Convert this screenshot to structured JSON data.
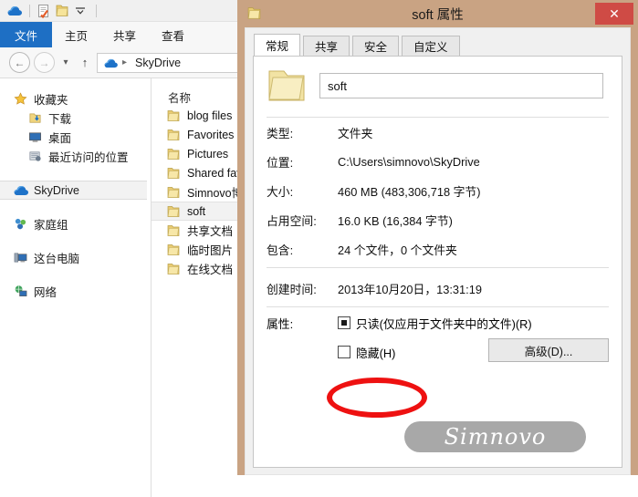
{
  "explorer": {
    "quick_access": {
      "skydrive_icon": "cloud-icon",
      "properties_icon": "properties-icon",
      "folder_icon": "folder-icon",
      "customize_icon": "chevron-down-icon"
    },
    "ribbon_tabs": [
      {
        "label": "文件",
        "active": true
      },
      {
        "label": "主页",
        "active": false
      },
      {
        "label": "共享",
        "active": false
      },
      {
        "label": "查看",
        "active": false
      }
    ],
    "address": {
      "back_icon": "back-arrow-icon",
      "forward_icon": "forward-arrow-icon",
      "history_icon": "chevron-down-icon",
      "up_icon": "up-arrow-icon",
      "location_icon": "cloud-icon",
      "crumb": "SkyDrive",
      "separator": "▸"
    },
    "nav_pane": [
      {
        "label": "收藏夹",
        "icon": "star-icon",
        "level": 1,
        "selected": false
      },
      {
        "label": "下载",
        "icon": "downloads-icon",
        "level": 2,
        "selected": false
      },
      {
        "label": "桌面",
        "icon": "desktop-icon",
        "level": 2,
        "selected": false
      },
      {
        "label": "最近访问的位置",
        "icon": "recent-places-icon",
        "level": 2,
        "selected": false
      },
      {
        "label": "SkyDrive",
        "icon": "cloud-icon",
        "level": 1,
        "selected": true
      },
      {
        "label": "家庭组",
        "icon": "homegroup-icon",
        "level": 1,
        "selected": false
      },
      {
        "label": "这台电脑",
        "icon": "computer-icon",
        "level": 1,
        "selected": false
      },
      {
        "label": "网络",
        "icon": "network-icon",
        "level": 1,
        "selected": false
      }
    ],
    "list": {
      "column_header": "名称",
      "rows": [
        {
          "name": "blog files",
          "icon": "folder-icon",
          "selected": false
        },
        {
          "name": "Favorites",
          "icon": "folder-icon",
          "selected": false
        },
        {
          "name": "Pictures",
          "icon": "folder-icon",
          "selected": false
        },
        {
          "name": "Shared favorites",
          "icon": "folder-icon",
          "selected": false
        },
        {
          "name": "Simnovo博客",
          "icon": "folder-icon",
          "selected": false
        },
        {
          "name": "soft",
          "icon": "folder-icon",
          "selected": true
        },
        {
          "name": "共享文档",
          "icon": "folder-icon",
          "selected": false
        },
        {
          "name": "临时图片",
          "icon": "folder-icon",
          "selected": false
        },
        {
          "name": "在线文档",
          "icon": "folder-icon",
          "selected": false
        }
      ]
    }
  },
  "dialog": {
    "title": "soft 属性",
    "title_icon": "folder-icon",
    "close_label": "✕",
    "tabs": [
      {
        "label": "常规",
        "active": true
      },
      {
        "label": "共享",
        "active": false
      },
      {
        "label": "安全",
        "active": false
      },
      {
        "label": "自定义",
        "active": false
      }
    ],
    "folder_icon": "large-folder-icon",
    "name_value": "soft",
    "fields": [
      {
        "label": "类型:",
        "value": "文件夹"
      },
      {
        "label": "位置:",
        "value": "C:\\Users\\simnovo\\SkyDrive"
      },
      {
        "label": "大小:",
        "value": "460 MB (483,306,718 字节)"
      },
      {
        "label": "占用空间:",
        "value": "16.0 KB (16,384 字节)"
      },
      {
        "label": "包含:",
        "value": "24 个文件，0 个文件夹"
      }
    ],
    "created": {
      "label": "创建时间:",
      "value": "2013年10月20日，13:31:19"
    },
    "attributes": {
      "label": "属性:",
      "readonly": {
        "label": "只读(仅应用于文件夹中的文件)(R)",
        "state": "indeterminate"
      },
      "hidden": {
        "label": "隐藏(H)",
        "state": "unchecked"
      },
      "advanced_button": "高级(D)..."
    },
    "annotation": {
      "type": "red-ellipse",
      "color": "#ee1111",
      "target": "hidden-checkbox"
    }
  },
  "watermark": {
    "text": "Simnovo",
    "color": "#a8a8a8"
  }
}
